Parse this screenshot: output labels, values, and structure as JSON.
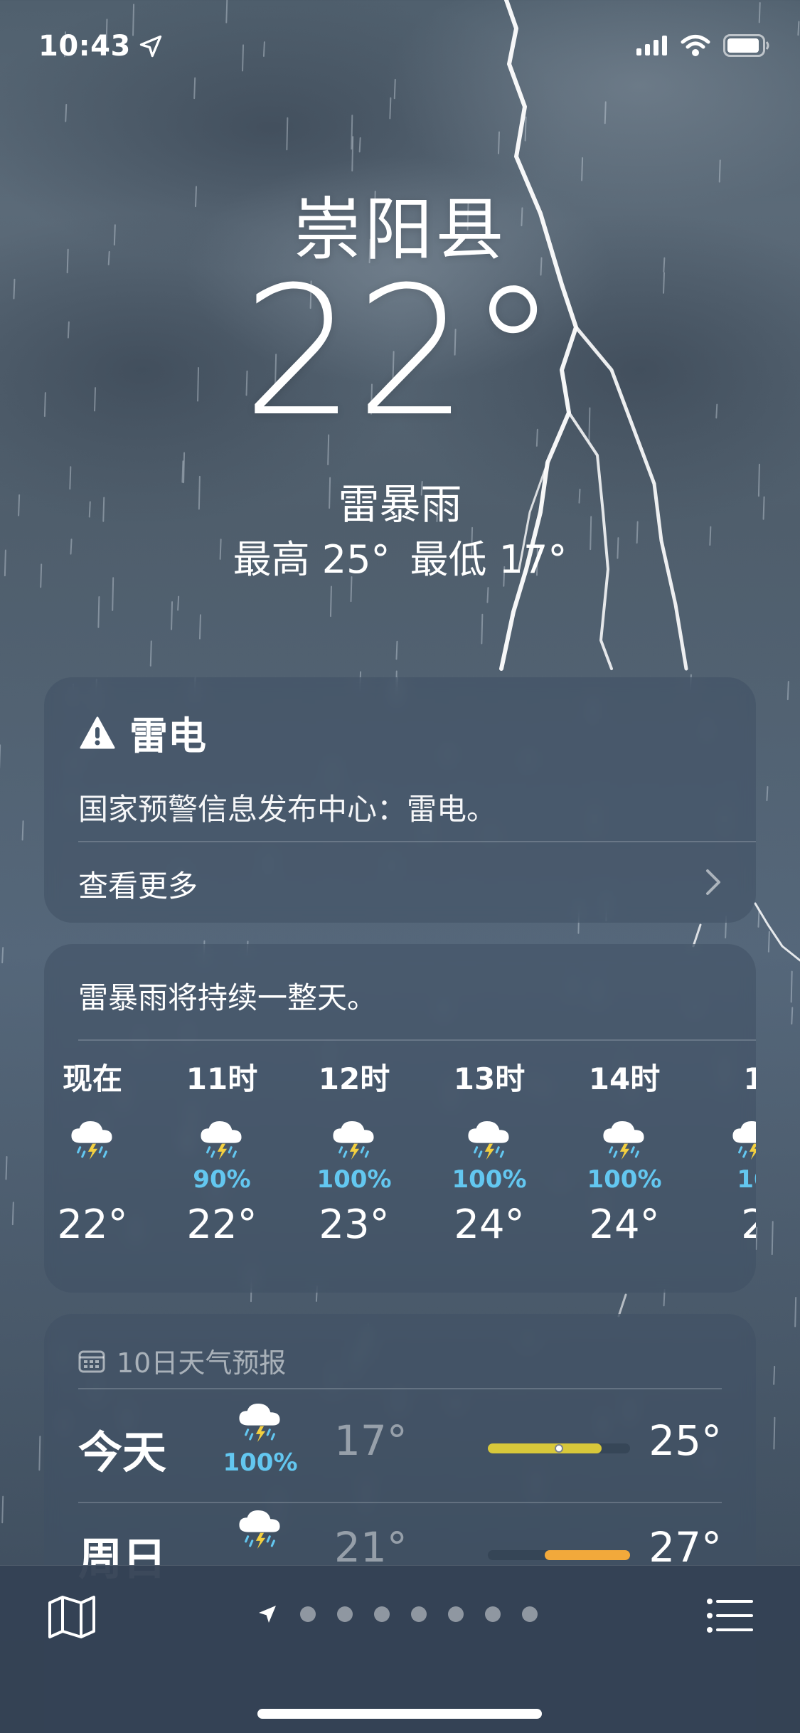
{
  "status_bar": {
    "time": "10:43",
    "icons": [
      "location-arrow-icon",
      "signal-icon",
      "wifi-icon",
      "battery-icon"
    ]
  },
  "location": {
    "name": "崇阳县"
  },
  "current": {
    "temperature": "22°",
    "condition": "雷暴雨",
    "high": "最高 25°",
    "low": "最低 17°"
  },
  "alert": {
    "title": "雷电",
    "icon": "warning-triangle-icon",
    "message": "国家预警信息发布中心：雷电。",
    "more_label": "查看更多"
  },
  "hourly": {
    "summary": "雷暴雨将持续一整天。",
    "items": [
      {
        "time": "现在",
        "icon": "thunderstorm-icon",
        "probability": "",
        "temp": "22°"
      },
      {
        "time": "11时",
        "icon": "thunderstorm-icon",
        "probability": "90%",
        "temp": "22°"
      },
      {
        "time": "12时",
        "icon": "thunderstorm-icon",
        "probability": "100%",
        "temp": "23°"
      },
      {
        "time": "13时",
        "icon": "thunderstorm-icon",
        "probability": "100%",
        "temp": "24°"
      },
      {
        "time": "14时",
        "icon": "thunderstorm-icon",
        "probability": "100%",
        "temp": "24°"
      },
      {
        "time": "1",
        "icon": "thunderstorm-icon",
        "probability": "10",
        "temp": "2"
      }
    ]
  },
  "daily": {
    "header": "10日天气预报",
    "header_icon": "calendar-icon",
    "days": [
      {
        "day": "今天",
        "icon": "thunderstorm-icon",
        "probability": "100%",
        "low": "17°",
        "high": "25°",
        "bar_color": "#d8c83a",
        "bar_start": 0,
        "bar_end": 0.8,
        "current_marker": 0.5
      },
      {
        "day": "周日",
        "icon": "thunderstorm-icon",
        "probability": "",
        "low": "21°",
        "high": "27°",
        "bar_color": "#f2a93b",
        "bar_start": 0.4,
        "bar_end": 1.0,
        "current_marker": null
      }
    ]
  },
  "bottom_bar": {
    "map_icon": "map-icon",
    "list_icon": "list-icon",
    "page_count": 7,
    "current_page": 0
  }
}
